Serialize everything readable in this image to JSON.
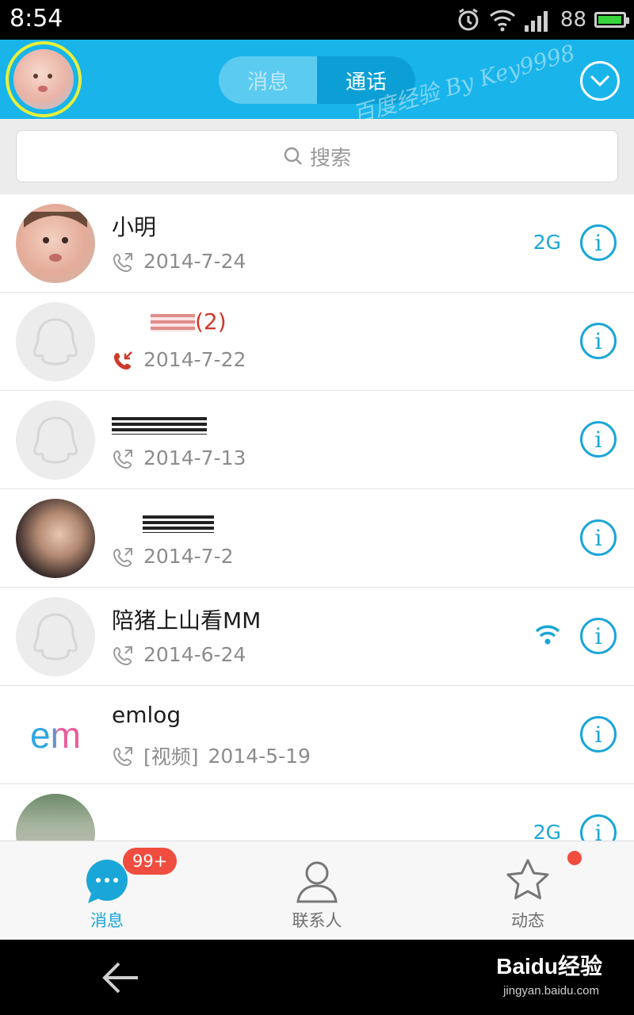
{
  "status_bar": {
    "time": "8:54",
    "battery": "88"
  },
  "header": {
    "tabs": [
      {
        "label": "消息",
        "active": false
      },
      {
        "label": "通话",
        "active": true
      }
    ],
    "watermark": "百度经验 By Key9998"
  },
  "search": {
    "placeholder": "搜索"
  },
  "calls": [
    {
      "name": "小明",
      "date": "2014-7-24",
      "type": "outgoing",
      "badge": "2G"
    },
    {
      "name": "(2)",
      "name_redacted": true,
      "date": "2014-7-22",
      "type": "missed"
    },
    {
      "name": "",
      "name_redacted": true,
      "date": "2014-7-13",
      "type": "outgoing"
    },
    {
      "name": "",
      "name_redacted": true,
      "date": "2014-7-2",
      "type": "outgoing"
    },
    {
      "name": "陪猪上山看MM",
      "date": "2014-6-24",
      "type": "outgoing",
      "badge": "wifi"
    },
    {
      "name": "emlog",
      "prefix": "[视频]",
      "date": "2014-5-19",
      "type": "outgoing",
      "avatar_text": "em"
    },
    {
      "name": "",
      "date": "",
      "badge": "2G"
    }
  ],
  "tab_bar": {
    "items": [
      {
        "label": "消息",
        "badge": "99+",
        "active": true
      },
      {
        "label": "联系人",
        "active": false
      },
      {
        "label": "动态",
        "active": false,
        "dot": true
      }
    ]
  },
  "nav_bar": {
    "brand": "Baidu经验",
    "url": "jingyan.baidu.com"
  },
  "colors": {
    "accent": "#19b4ea",
    "missed": "#d0392b",
    "badge": "#ef4d3f"
  }
}
